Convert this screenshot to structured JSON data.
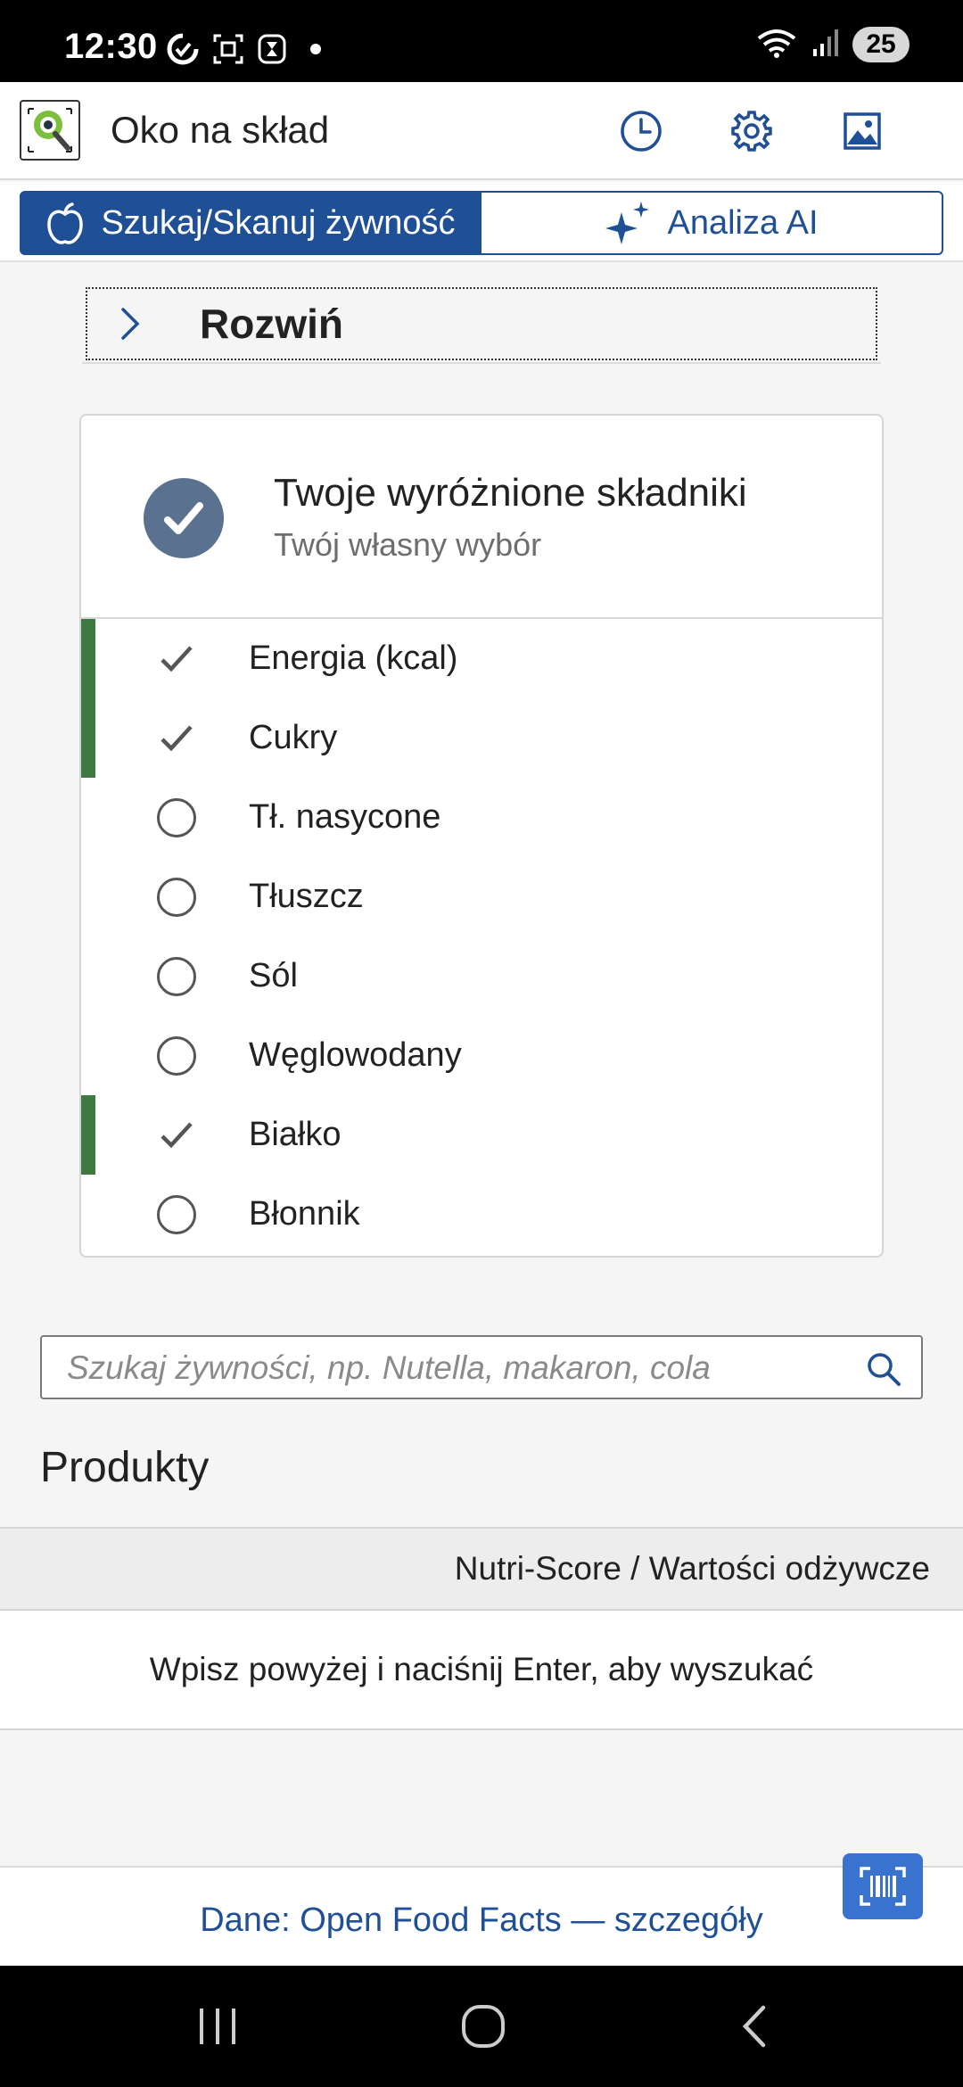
{
  "status_bar": {
    "time": "12:30",
    "battery": "25",
    "icons_left": [
      "sync-icon",
      "screenshot-icon",
      "timer-icon",
      "dot-icon"
    ],
    "icons_right": [
      "wifi-icon",
      "signal-icon",
      "battery-icon"
    ]
  },
  "header": {
    "title": "Oko na skład",
    "actions": [
      "history-icon",
      "settings-icon",
      "image-icon"
    ]
  },
  "tabs": [
    {
      "label": "Szukaj/Skanuj żywność",
      "icon": "apple-icon",
      "active": true
    },
    {
      "label": "Analiza AI",
      "icon": "sparkle-icon",
      "active": false
    }
  ],
  "expand": {
    "label": "Rozwiń",
    "icon": "chevron-right-icon"
  },
  "highlight_card": {
    "title": "Twoje wyróżnione składniki",
    "subtitle": "Twój własny wybór",
    "items": [
      {
        "label": "Energia (kcal)",
        "selected": true
      },
      {
        "label": "Cukry",
        "selected": true
      },
      {
        "label": "Tł. nasycone",
        "selected": false
      },
      {
        "label": "Tłuszcz",
        "selected": false
      },
      {
        "label": "Sól",
        "selected": false
      },
      {
        "label": "Węglowodany",
        "selected": false
      },
      {
        "label": "Białko",
        "selected": true
      },
      {
        "label": "Błonnik",
        "selected": false
      }
    ]
  },
  "search": {
    "placeholder": "Szukaj żywności, np. Nutella, makaron, cola",
    "value": ""
  },
  "products": {
    "title": "Produkty",
    "column_header": "Nutri-Score / Wartości odżywcze",
    "empty_message": "Wpisz powyżej i naciśnij Enter, aby wyszukać"
  },
  "footer": {
    "link": "Dane: Open Food Facts — szczegóły"
  },
  "colors": {
    "primary": "#1f4f95",
    "accent": "#3a72d0",
    "selected_marker": "#3d7a3f",
    "badge": "#5b7190"
  }
}
